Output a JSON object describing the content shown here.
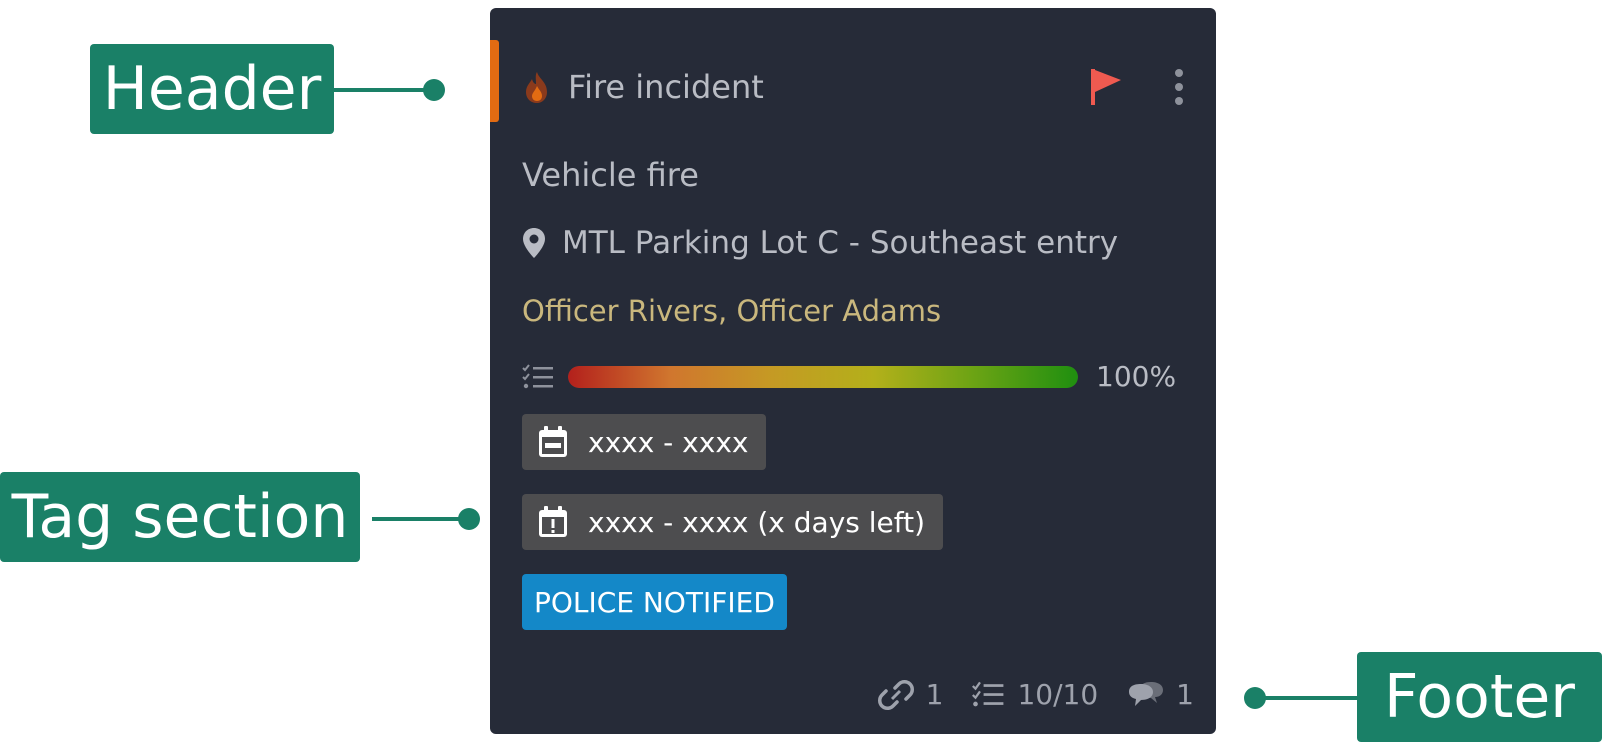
{
  "annotations": {
    "header": "Header",
    "tag_section": "Tag section",
    "footer": "Footer"
  },
  "card": {
    "accent_color": "#e26b12",
    "header": {
      "icon": "fire-icon",
      "title": "Fire incident",
      "flag_icon": "flag-icon",
      "menu_icon": "kebab-menu-icon"
    },
    "subtitle": "Vehicle fire",
    "location": {
      "icon": "location-pin-icon",
      "text": "MTL Parking Lot C - Southeast entry"
    },
    "assignees": "Officer Rivers, Officer Adams",
    "progress": {
      "icon": "checklist-icon",
      "value_percent": 100,
      "label": "100%"
    },
    "tags": {
      "date_range": "xxxx - xxxx",
      "due_date": "xxxx - xxxx (x days left)",
      "status": "POLICE NOTIFIED",
      "status_color": "#1488c8"
    },
    "footer": {
      "links_count": "1",
      "checklist_count": "10/10",
      "comments_count": "1"
    }
  }
}
